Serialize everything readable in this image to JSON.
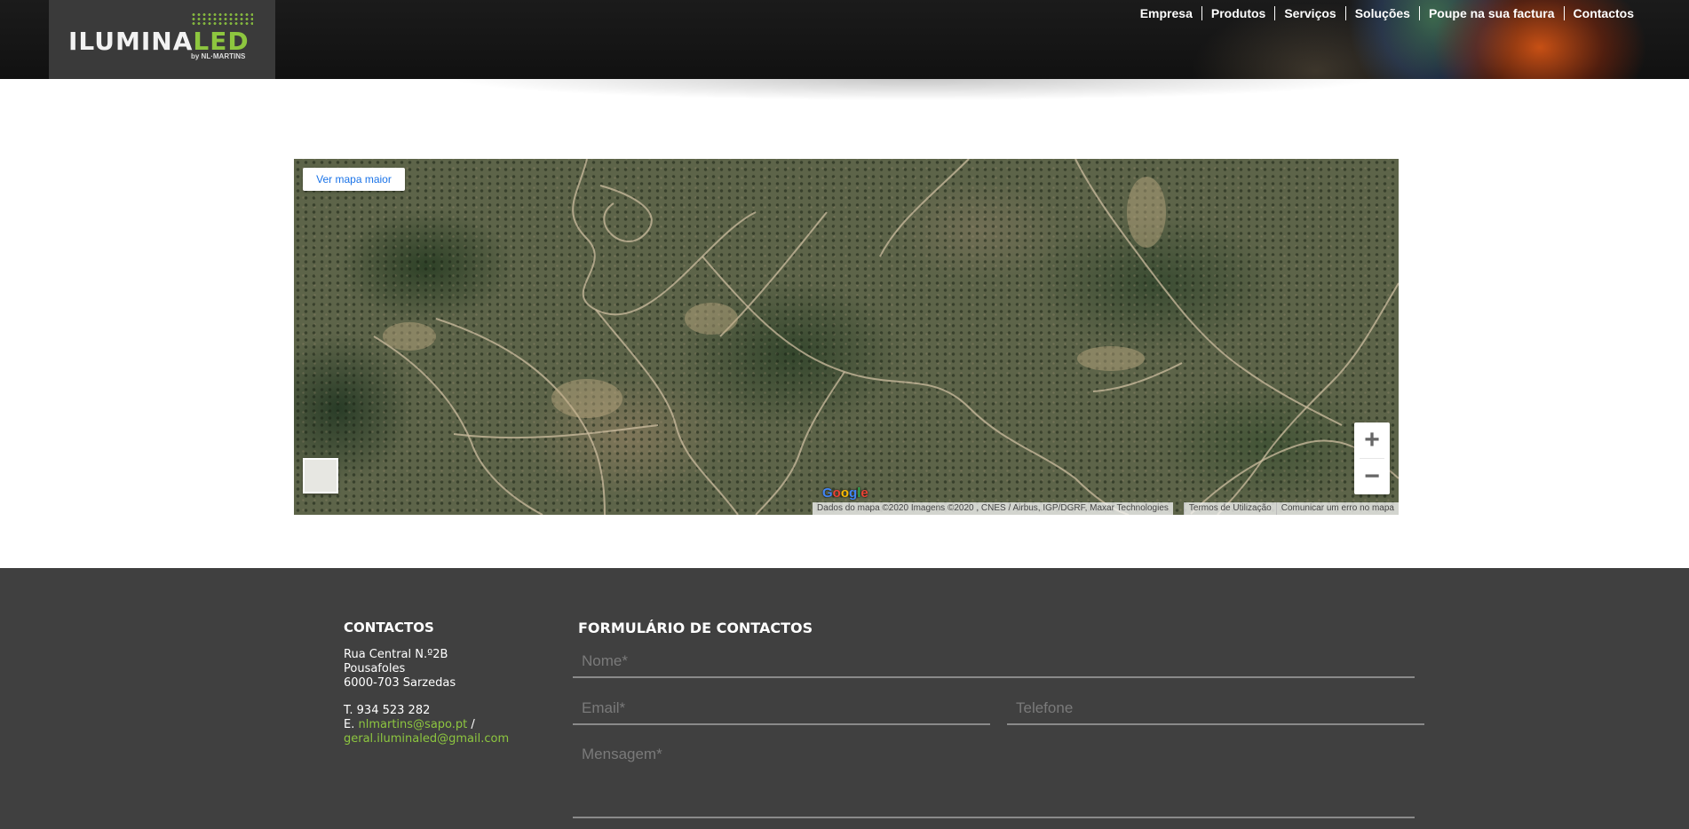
{
  "brand": {
    "logo_main": "ILUMINA",
    "logo_accent": "LED",
    "logo_sub": "by NL·MARTINS",
    "accent_color": "#8dc63f"
  },
  "nav": {
    "items": [
      {
        "label": "Empresa"
      },
      {
        "label": "Produtos"
      },
      {
        "label": "Serviços"
      },
      {
        "label": "Soluções"
      },
      {
        "label": "Poupe na sua factura"
      },
      {
        "label": "Contactos"
      }
    ]
  },
  "map": {
    "larger_map_label": "Ver mapa maior",
    "zoom_in": "+",
    "zoom_out": "−",
    "google": [
      "G",
      "o",
      "o",
      "g",
      "l",
      "e"
    ],
    "attribution": "Dados do mapa ©2020 Imagens ©2020 , CNES / Airbus, IGP/DGRF, Maxar Technologies",
    "terms_label": "Termos de Utilização",
    "report_label": "Comunicar um erro no mapa",
    "icons": [
      "zoom-in-icon",
      "zoom-out-icon",
      "map-type-icon"
    ]
  },
  "contacts": {
    "heading": "CONTACTOS",
    "address_line1": "Rua Central N.º2B",
    "address_line2": "Pousafoles",
    "address_line3": "6000-703 Sarzedas",
    "phone": "T. 934 523 282",
    "email_prefix": "E.",
    "email1": "nlmartins@sapo.pt",
    "email_sep": "/",
    "email2": "geral.iluminaled@gmail.com"
  },
  "form": {
    "title": "FORMULÁRIO DE CONTACTOS",
    "nome_placeholder": "Nome*",
    "email_placeholder": "Email*",
    "telefone_placeholder": "Telefone",
    "mensagem_placeholder": "Mensagem*"
  }
}
